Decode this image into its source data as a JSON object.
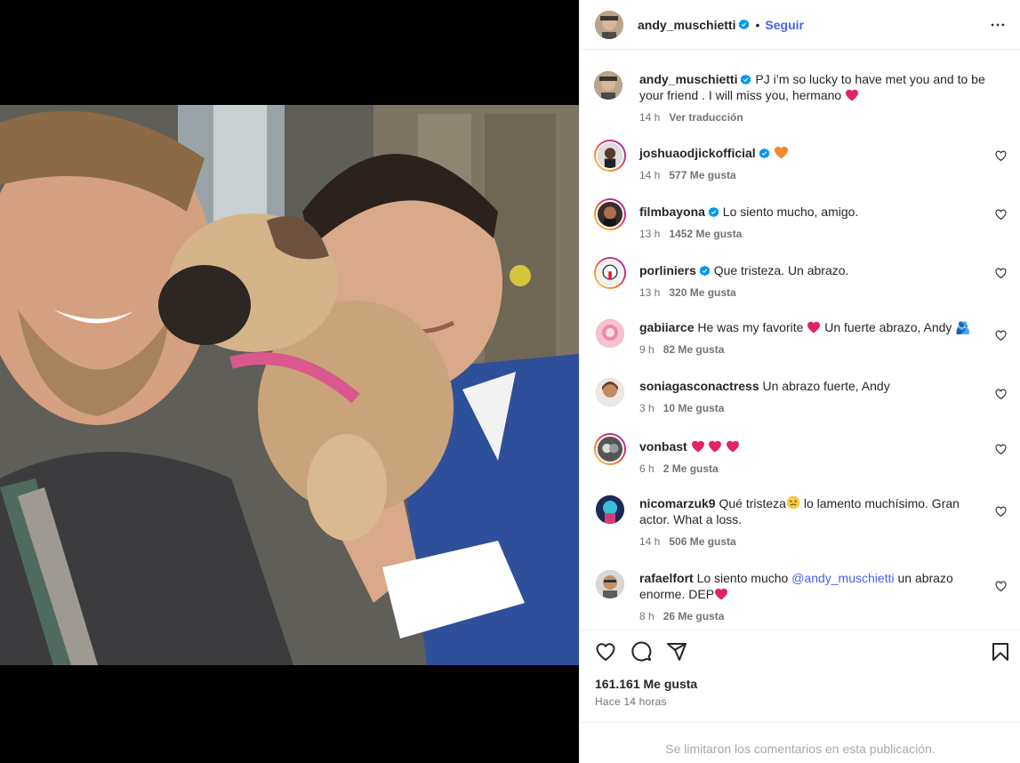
{
  "post": {
    "author": "andy_muschietti",
    "follow_label": "Seguir",
    "dot": "•",
    "caption_text": "PJ i’m so lucky to have met you and to be your friend . I will miss you, hermano",
    "caption_time": "14 h",
    "translate_label": "Ver traducción",
    "likes": "161.161 Me gusta",
    "time_ago": "Hace 14 horas",
    "comments_limited": "Se limitaron los comentarios en esta publicación."
  },
  "comments": [
    {
      "user": "joshuaodjickofficial",
      "text": "",
      "time": "14 h",
      "likes": "577 Me gusta"
    },
    {
      "user": "filmbayona",
      "text": "Lo siento mucho, amigo.",
      "time": "13 h",
      "likes": "1452 Me gusta"
    },
    {
      "user": "porliniers",
      "text": "Que tristeza. Un abrazo.",
      "time": "13 h",
      "likes": "320 Me gusta"
    },
    {
      "user": "gabiiarce",
      "text_a": "He was my favorite",
      "text_b": "Un fuerte abrazo, Andy 🫂",
      "time": "9 h",
      "likes": "82 Me gusta"
    },
    {
      "user": "soniagasconactress",
      "text": "Un abrazo fuerte, Andy",
      "time": "3 h",
      "likes": "10 Me gusta"
    },
    {
      "user": "vonbast",
      "text": "",
      "time": "6 h",
      "likes": "2 Me gusta"
    },
    {
      "user": "nicomarzuk9",
      "text_a": "Qué tristeza",
      "text_b": "lo lamento muchísimo. Gran actor. What a loss.",
      "time": "14 h",
      "likes": "506 Me gusta"
    },
    {
      "user": "rafaelfort",
      "text_a": "Lo siento mucho",
      "mention": "@andy_muschietti",
      "text_b": "un abrazo enorme. DEP",
      "time": "8 h",
      "likes": "26 Me gusta"
    }
  ],
  "colors": {
    "accent_blue": "#4a5df9",
    "verified_blue": "#0095f6",
    "heart_red": "#e0245e",
    "orange_heart": "#f4892f",
    "secondary_text": "#737373"
  },
  "icons": [
    "more-icon",
    "verified-badge-icon",
    "heart-icon",
    "comment-icon",
    "share-icon",
    "save-icon"
  ]
}
